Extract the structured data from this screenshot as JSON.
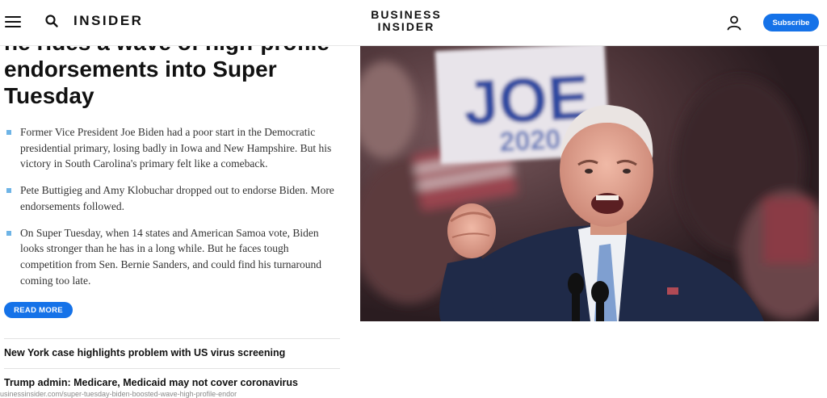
{
  "header": {
    "menu_icon": "hamburger-icon",
    "search_icon": "search-icon",
    "section_logo": "INSIDER",
    "brand_line1": "BUSINESS",
    "brand_line2": "INSIDER",
    "user_icon": "user-icon",
    "subscribe_label": "Subscribe"
  },
  "article": {
    "headline": "he rides a wave of high-profile endorsements into Super Tuesday",
    "bullets": [
      "Former Vice President Joe Biden had a poor start in the Democratic presidential primary, losing badly in Iowa and New Hampshire. But his victory in South Carolina's primary felt like a comeback.",
      "Pete Buttigieg and Amy Klobuchar dropped out to endorse Biden. More endorsements followed.",
      "On Super Tuesday, when 14 states and American Samoa vote, Biden looks stronger than he has in a long while. But he faces tough competition from Sen. Bernie Sanders, and could find his turnaround coming too late."
    ],
    "read_more_label": "READ MORE",
    "photo": {
      "sign_text": "JOE",
      "sign_sub": "2020"
    }
  },
  "more_stories": [
    "New York case highlights problem with US virus screening",
    "Trump admin: Medicare, Medicaid may not cover coronavirus"
  ],
  "status_bar_url": "usinessinsider.com/super-tuesday-biden-boosted-wave-high-profile-endor",
  "colors": {
    "accent": "#1572e8",
    "bullet": "#6eb4e6"
  }
}
